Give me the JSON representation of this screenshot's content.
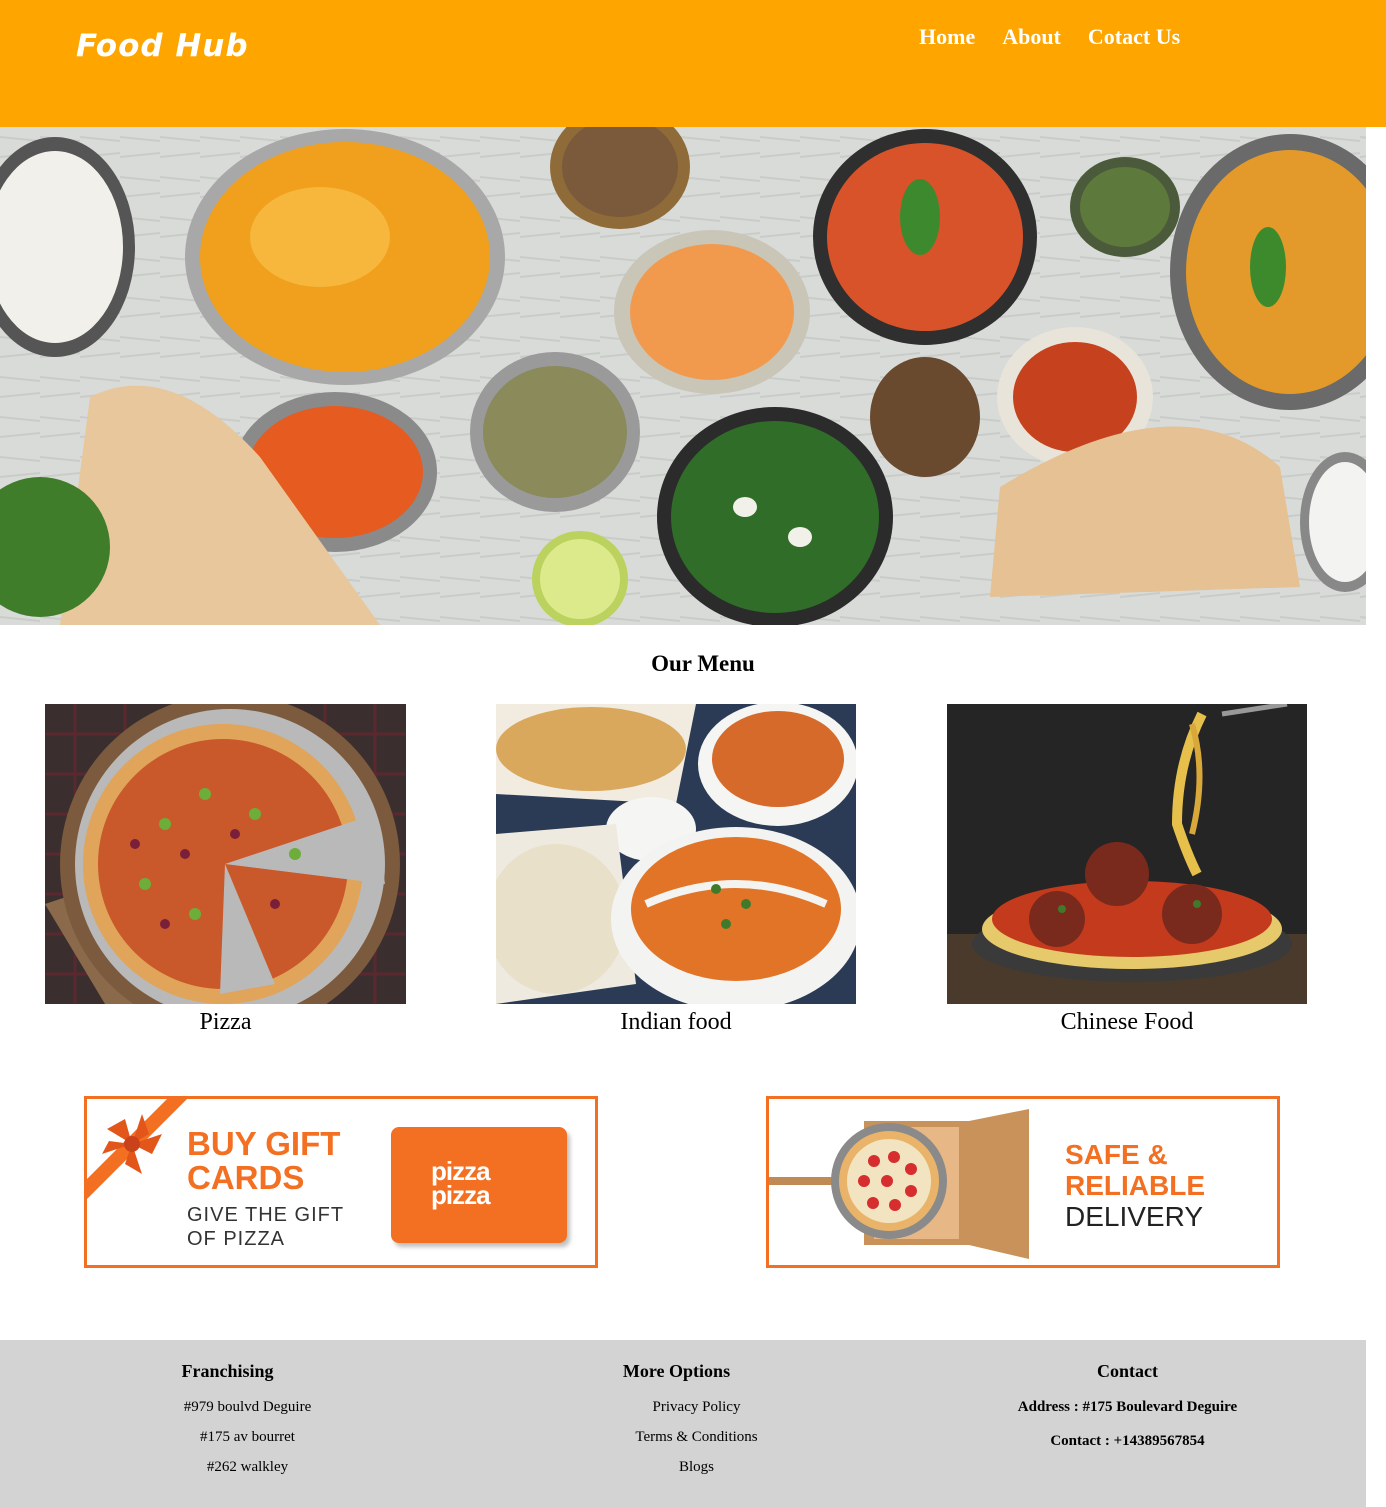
{
  "header": {
    "brand": "Food Hub",
    "nav": [
      {
        "label": "Home"
      },
      {
        "label": "About"
      },
      {
        "label": "Cotact Us"
      }
    ]
  },
  "menu": {
    "title": "Our Menu",
    "items": [
      {
        "label": "Pizza"
      },
      {
        "label": "Indian food"
      },
      {
        "label": "Chinese Food"
      }
    ]
  },
  "promos": {
    "gift": {
      "line1": "BUY GIFT",
      "line2": "CARDS",
      "sub1": "GIVE THE GIFT",
      "sub2": "OF PIZZA",
      "card_logo_top": "pizza",
      "card_logo_bottom": "pizza"
    },
    "delivery": {
      "line1": "SAFE &",
      "line2": "RELIABLE",
      "line3": "DELIVERY"
    }
  },
  "footer": {
    "franchising": {
      "title": "Franchising",
      "items": [
        "#979 boulvd Deguire",
        "#175 av bourret",
        "#262 walkley"
      ]
    },
    "more": {
      "title": "More Options",
      "items": [
        "Privacy Policy",
        "Terms & Conditions",
        "Blogs"
      ]
    },
    "contact": {
      "title": "Contact",
      "address": "Address : #175 Boulevard Deguire",
      "phone": "Contact : +14389567854"
    }
  },
  "colors": {
    "header": "#ffa500",
    "accent": "#f36f21",
    "footer": "#d3d3d3"
  }
}
